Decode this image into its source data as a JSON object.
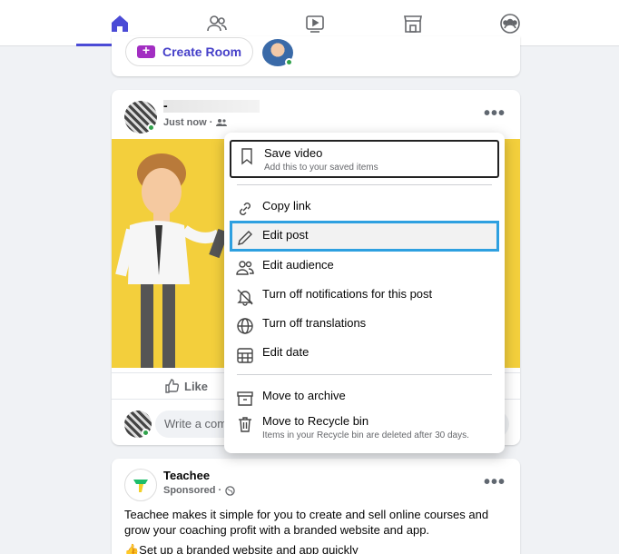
{
  "nav": {
    "tabs": [
      {
        "name": "home",
        "icon": "home-icon",
        "active": true
      },
      {
        "name": "friends",
        "icon": "friends-icon"
      },
      {
        "name": "watch",
        "icon": "watch-icon"
      },
      {
        "name": "marketplace",
        "icon": "marketplace-icon"
      },
      {
        "name": "groups",
        "icon": "groups-icon"
      }
    ],
    "accent": "#4b4bd6"
  },
  "rooms": {
    "create_label": "Create Room"
  },
  "post": {
    "author_prefix": "-",
    "time": "Just now ·",
    "like_label": "Like",
    "comment_placeholder": "Write a comment..."
  },
  "menu": {
    "items": [
      {
        "label": "Save video",
        "sub": "Add this to your saved items",
        "icon": "bookmark-icon"
      },
      {
        "label": "Copy link",
        "icon": "link-icon"
      },
      {
        "label": "Edit post",
        "icon": "pencil-icon"
      },
      {
        "label": "Edit audience",
        "icon": "audience-icon"
      },
      {
        "label": "Turn off notifications for this post",
        "icon": "bell-off-icon"
      },
      {
        "label": "Turn off translations",
        "icon": "globe-icon"
      },
      {
        "label": "Edit date",
        "icon": "calendar-icon"
      },
      {
        "label": "Move to archive",
        "icon": "archive-icon"
      },
      {
        "label": "Move to Recycle bin",
        "sub": "Items in your Recycle bin are deleted after 30 days.",
        "icon": "trash-icon"
      }
    ],
    "highlight_color": "#2ea0e0"
  },
  "sponsored": {
    "name": "Teachee",
    "meta": "Sponsored ·",
    "text": "Teachee makes it simple for you to create and sell online courses and grow your coaching profit with a branded website and app.",
    "text2": "👍Set up a branded website and app quickly"
  }
}
